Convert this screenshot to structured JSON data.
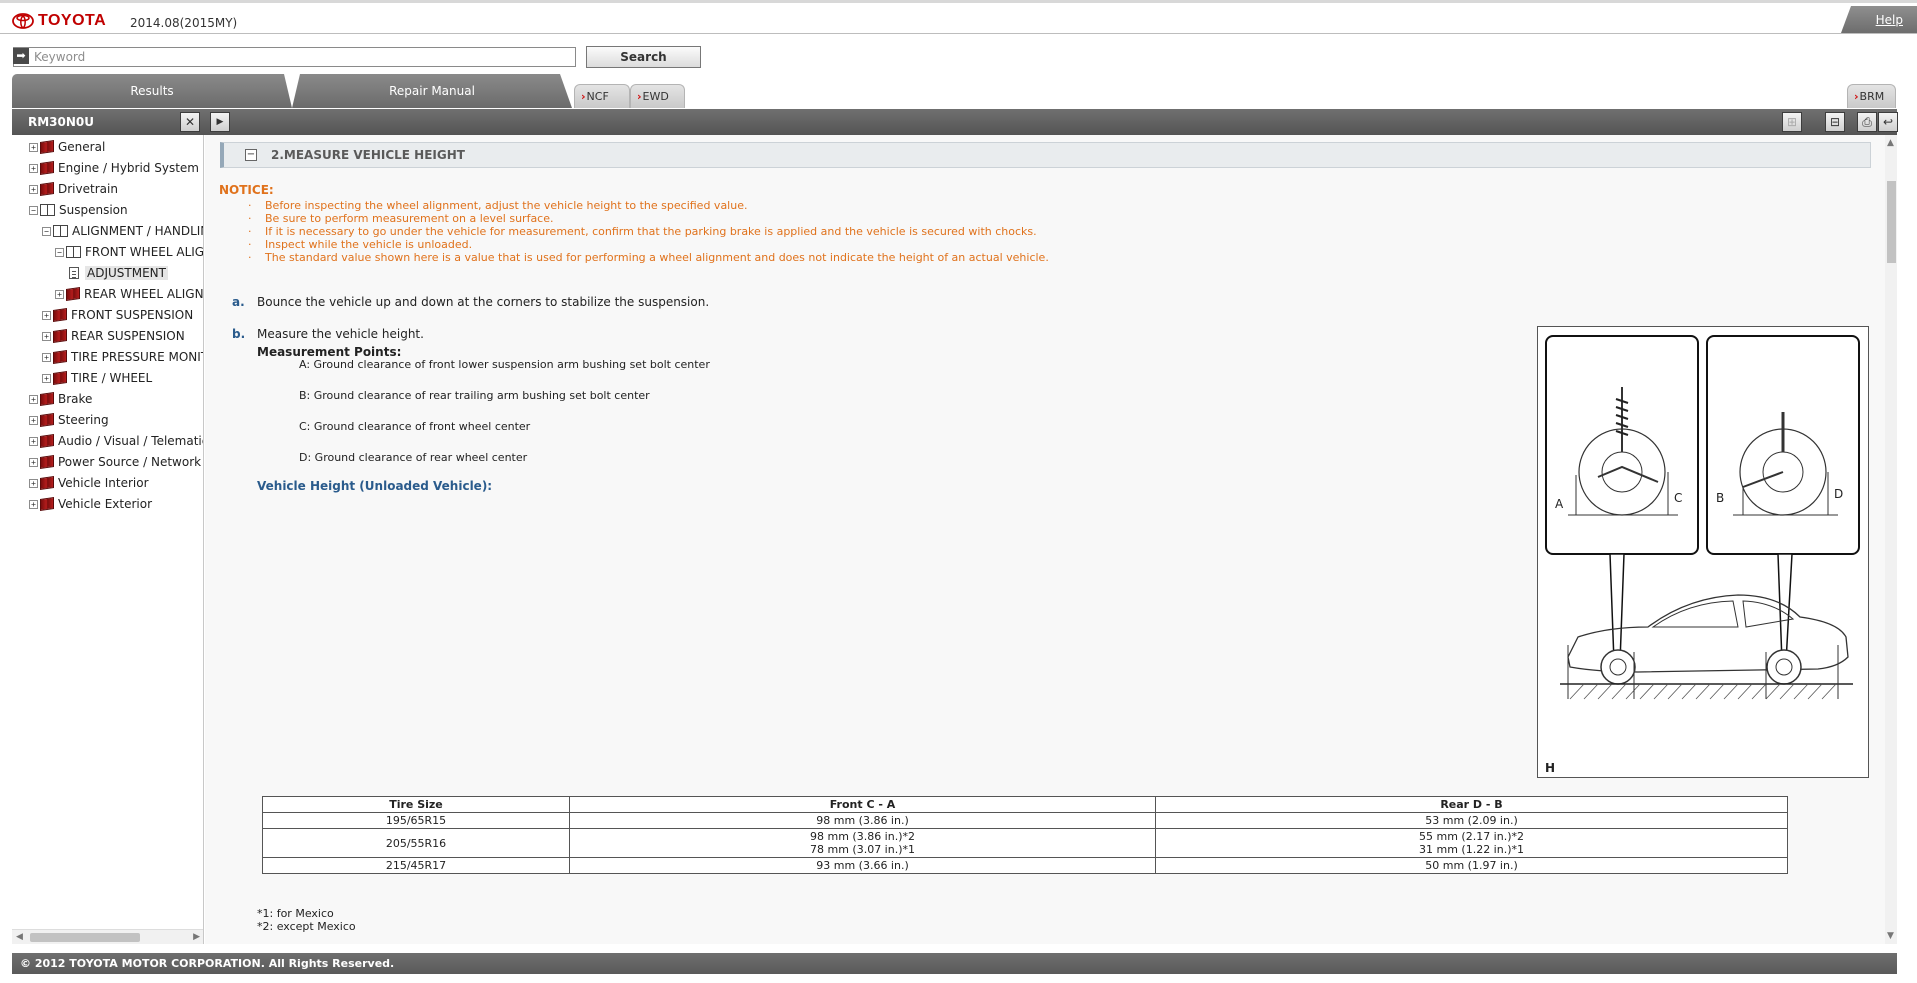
{
  "header": {
    "brand": "TOYOTA",
    "version": "2014.08(2015MY)",
    "help_label": "Help"
  },
  "search": {
    "placeholder": "Keyword",
    "button_label": "Search"
  },
  "tabs": {
    "results": "Results",
    "repair_manual": "Repair Manual",
    "ncf": "NCF",
    "ewd": "EWD",
    "brm": "BRM"
  },
  "toolbar": {
    "manual_id": "RM30N0U"
  },
  "tree": {
    "general": "General",
    "engine": "Engine / Hybrid System",
    "drivetrain": "Drivetrain",
    "suspension": "Suspension",
    "alignment": "ALIGNMENT / HANDLING",
    "front_wheel_alignment": "FRONT WHEEL ALIGNMENT",
    "adjustment": "ADJUSTMENT",
    "rear_wheel_alignment": "REAR WHEEL ALIGNMENT",
    "front_suspension": "FRONT SUSPENSION",
    "rear_suspension": "REAR SUSPENSION",
    "tire_pressure": "TIRE PRESSURE MONITORING",
    "tire_wheel": "TIRE / WHEEL",
    "brake": "Brake",
    "steering": "Steering",
    "audio": "Audio / Visual / Telematics",
    "power_source": "Power Source / Network",
    "vehicle_interior": "Vehicle Interior",
    "vehicle_exterior": "Vehicle Exterior"
  },
  "content": {
    "section_title": "2.MEASURE VEHICLE HEIGHT",
    "notice_label": "NOTICE:",
    "notice_bullet": "·",
    "notices": [
      "Before inspecting the wheel alignment, adjust the vehicle height to the specified value.",
      "Be sure to perform measurement on a level surface.",
      "If it is necessary to go under the vehicle for measurement, confirm that the parking brake is applied and the vehicle is secured with chocks.",
      "Inspect while the vehicle is unloaded.",
      "The standard value shown here is a value that is used for performing a wheel alignment and does not indicate the height of an actual vehicle."
    ],
    "step_a_letter": "a.",
    "step_a_text": "Bounce the vehicle up and down at the corners to stabilize the suspension.",
    "step_b_letter": "b.",
    "step_b_text": "Measure the vehicle height.",
    "measurement_points_label": "Measurement Points:",
    "measurement_points": [
      "A: Ground clearance of front lower suspension arm bushing set bolt center",
      "B: Ground clearance of rear trailing arm bushing set bolt center",
      "C: Ground clearance of front wheel center",
      "D: Ground clearance of rear wheel center"
    ],
    "vehicle_height_label": "Vehicle Height (Unloaded Vehicle):",
    "illustration": {
      "label_a": "A",
      "label_b": "B",
      "label_c": "C",
      "label_d": "D",
      "label_h": "H"
    },
    "table": {
      "headers": [
        "Tire Size",
        "Front C - A",
        "Rear D - B"
      ],
      "rows": [
        {
          "tire": "195/65R15",
          "front_1": "98 mm (3.86 in.)",
          "front_2": "",
          "rear_1": "53 mm (2.09 in.)",
          "rear_2": ""
        },
        {
          "tire": "205/55R16",
          "front_1": "98 mm (3.86 in.)*2",
          "front_2": "78 mm (3.07 in.)*1",
          "rear_1": "55 mm (2.17 in.)*2",
          "rear_2": "31 mm (1.22 in.)*1"
        },
        {
          "tire": "215/45R17",
          "front_1": "93 mm (3.66 in.)",
          "front_2": "",
          "rear_1": "50 mm (1.97 in.)",
          "rear_2": ""
        }
      ]
    },
    "footnotes": [
      "*1: for Mexico",
      "*2: except Mexico"
    ]
  },
  "footer": {
    "copyright": "© 2012 TOYOTA MOTOR CORPORATION. All Rights Reserved."
  },
  "colors": {
    "brand_red": "#c00000",
    "notice_orange": "#e0721c",
    "step_blue": "#2a5b8c",
    "toolbar_gray": "#606060"
  }
}
